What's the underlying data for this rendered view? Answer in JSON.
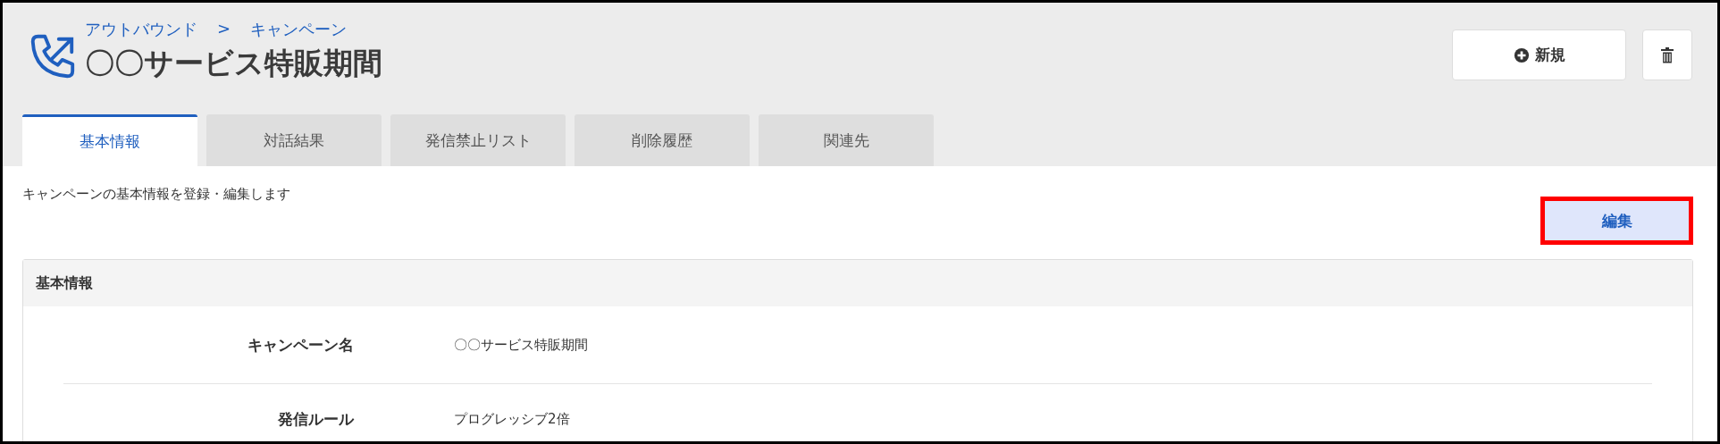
{
  "header": {
    "breadcrumb": [
      {
        "label": "アウトバウンド"
      },
      {
        "label": "キャンペーン"
      }
    ],
    "separator": ">",
    "title": "〇〇サービス特販期間"
  },
  "actions": {
    "new_button": "新規",
    "delete_button": {
      "kind": "trash"
    }
  },
  "tabs": [
    {
      "label": "基本情報",
      "selected": true
    },
    {
      "label": "対話結果",
      "selected": false
    },
    {
      "label": "発信禁止リスト",
      "selected": false
    },
    {
      "label": "削除履歴",
      "selected": false
    },
    {
      "label": "関連先",
      "selected": false
    }
  ],
  "description": "キャンペーンの基本情報を登録・編集します",
  "edit_button": {
    "label": "編集",
    "highlighted": true
  },
  "card": {
    "title": "基本情報",
    "fields": [
      {
        "label": "キャンペーン名",
        "value": "〇〇サービス特販期間"
      },
      {
        "label": "発信ルール",
        "value": "プログレッシブ2倍"
      }
    ]
  }
}
